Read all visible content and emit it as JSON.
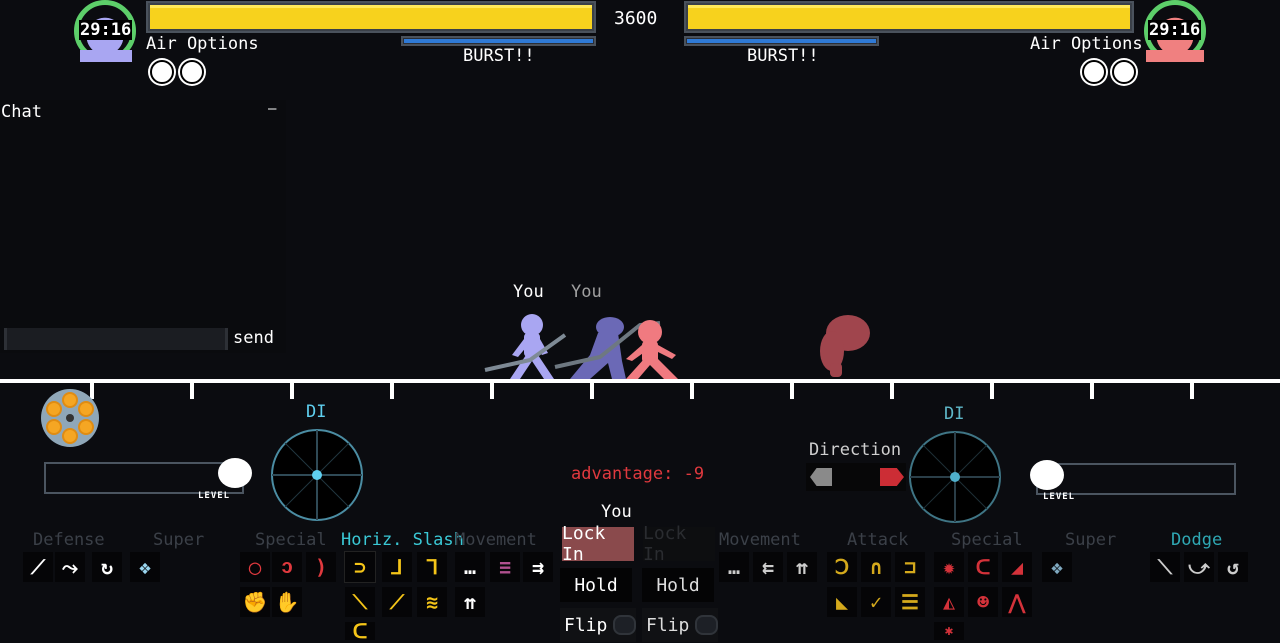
{
  "hud": {
    "timer_center": "3600",
    "p1": {
      "portrait_timer": "29:16",
      "hp_fraction": 1.0,
      "burst_fraction": 1.0,
      "air_options_label": "Air Options",
      "air_options_count": 2,
      "burst_label": "BURST!!",
      "color": "#a9a6f2"
    },
    "p2": {
      "portrait_timer": "29:16",
      "hp_fraction": 1.0,
      "burst_fraction": 1.0,
      "air_options_label": "Air Options",
      "air_options_count": 2,
      "burst_label": "BURST!!",
      "color": "#f08080"
    }
  },
  "chat": {
    "title": "Chat",
    "minimize_label": "—",
    "input_value": "",
    "send_label": "send"
  },
  "stage": {
    "name_tag_p1": "You",
    "name_tag_ghost": "You"
  },
  "left_panel": {
    "di_label": "DI",
    "level_label": "LEVEL"
  },
  "right_panel": {
    "di_label": "DI",
    "direction_label": "Direction",
    "level_label": "LEVEL"
  },
  "center": {
    "advantage": "advantage: -9",
    "you_label": "You",
    "lock_in_p1": "Lock In",
    "lock_in_p2": "Lock In",
    "hold_p1": "Hold",
    "hold_p2": "Hold",
    "flip_p1": "Flip",
    "flip_p2": "Flip"
  },
  "colors": {
    "hp_yellow": "#f7d21d",
    "burst_blue": "#2f7ad6",
    "di_cyan": "#5fd0f0",
    "active_category": "#3ac9d6",
    "advantage_red": "#e0393e",
    "special_red": "#e0393e",
    "attack_yellow": "#f5c518"
  },
  "p1_actions": {
    "categories": [
      "Defense",
      "Super",
      "Special",
      "Horiz. Slash",
      "Movement"
    ],
    "active_category": "Horiz. Slash",
    "defense": [
      "block-icon",
      "parry-icon",
      "reset-icon"
    ],
    "super": [
      "super-burst-icon"
    ],
    "special": [
      "whirl-icon",
      "spin-icon",
      "burst-ring-icon",
      "tackle-icon",
      "fist-icon"
    ],
    "horiz_slash": [
      "horiz-slash-icon",
      "down-slash-icon",
      "up-slash-icon",
      "jab-icon",
      "stab-icon",
      "sweep-icon",
      "hook-icon"
    ],
    "movement": [
      "wait-icon",
      "dash-icon",
      "double-right-icon",
      "double-jump-icon"
    ]
  },
  "p2_actions": {
    "categories": [
      "Movement",
      "Attack",
      "Special",
      "Super",
      "Dodge"
    ],
    "active_category": "Dodge",
    "movement": [
      "wait-icon",
      "double-left-icon",
      "double-jump-icon"
    ],
    "attack": [
      "hook-icon",
      "magnet-icon",
      "grab-icon",
      "kick-icon",
      "broom-icon",
      "ladder-icon"
    ],
    "special": [
      "gear-icon",
      "whip-icon",
      "slide-icon",
      "charge-icon",
      "bomb-icon",
      "spikes-icon",
      "bug-icon"
    ],
    "super": [
      "super-burst-icon"
    ],
    "dodge": [
      "roll-back-icon",
      "roll-forward-icon",
      "undo-icon"
    ]
  }
}
